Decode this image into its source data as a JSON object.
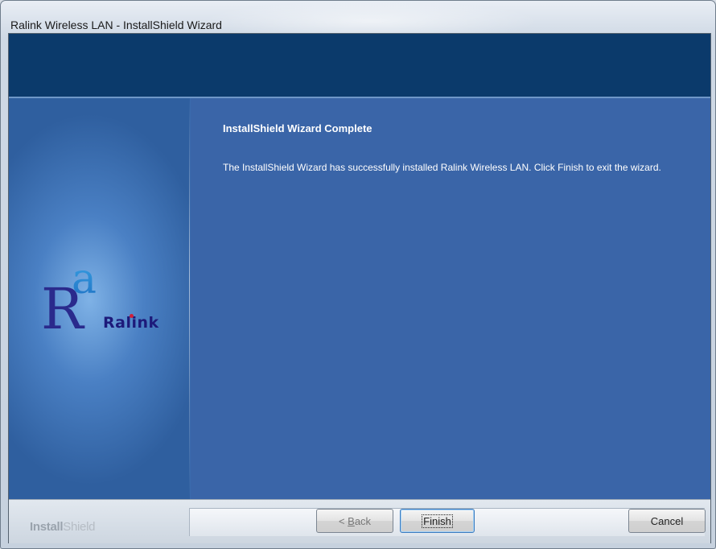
{
  "window": {
    "title": "Ralink Wireless LAN - InstallShield Wizard"
  },
  "content": {
    "heading": "InstallShield Wizard Complete",
    "message": "The InstallShield Wizard has successfully installed Ralink Wireless LAN.  Click Finish to exit the wizard."
  },
  "logo": {
    "word_before_dot": "Ral",
    "word_after_dot": "nk",
    "colors": {
      "text": "#1d1a7a",
      "dot": "#d11f3a",
      "mark_top": "#3aa6e6",
      "mark_bottom": "#2a2a8c"
    }
  },
  "footer": {
    "brand_bold": "Install",
    "brand_light": "Shield"
  },
  "buttons": {
    "back_label_prefix": "< ",
    "back_label_access": "B",
    "back_label_rest": "ack",
    "finish_label": "Finish",
    "cancel_label": "Cancel"
  },
  "colors": {
    "banner": "#0b3a6b",
    "panel": "#3a65a8"
  }
}
